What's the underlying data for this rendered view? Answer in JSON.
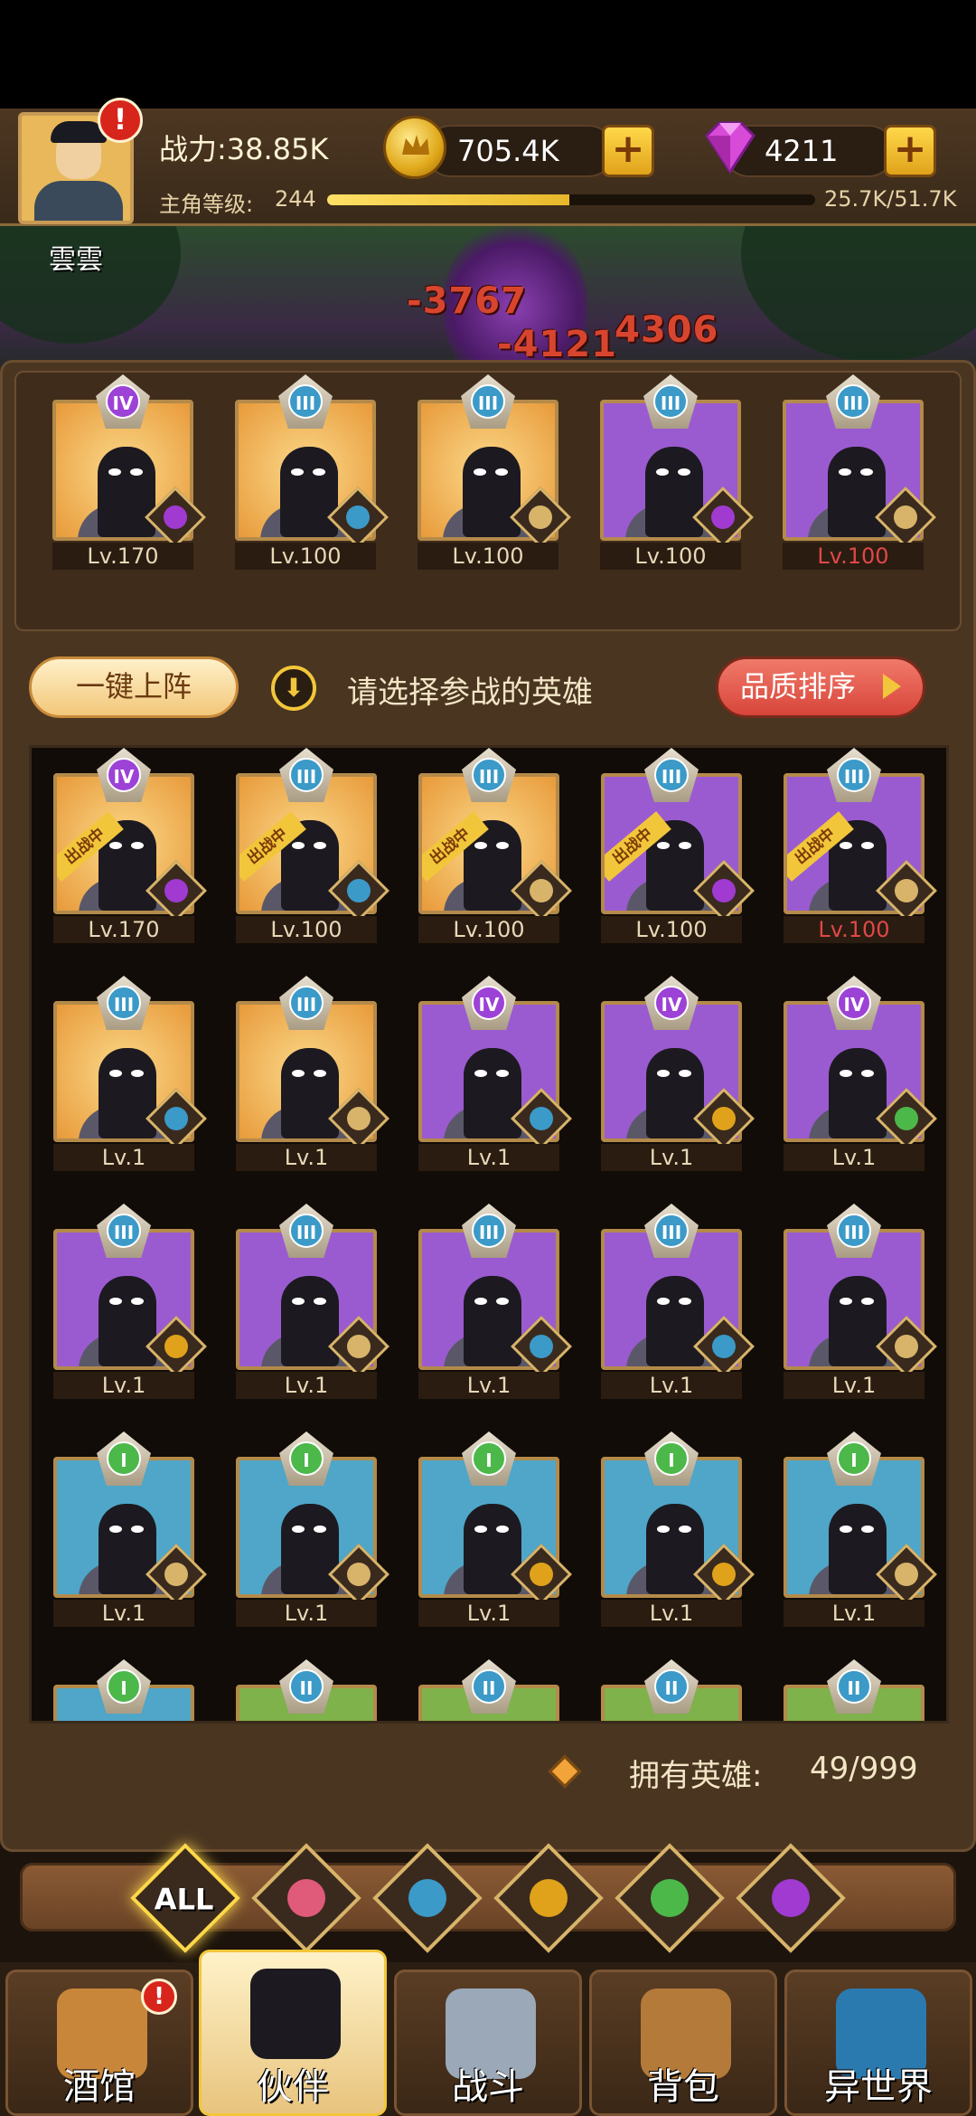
{
  "player": {
    "name": "雲雲",
    "power_text": "战力:38.85K",
    "level_label": "主角等级:",
    "level_value": "244",
    "xp_text": "25.7K/51.7K",
    "xp_progress": 0.497
  },
  "resources": {
    "gold": "705.4K",
    "gems": "4211"
  },
  "battle": {
    "damage_numbers": [
      "-3767",
      "-4121",
      "4306"
    ]
  },
  "team": [
    {
      "rank": "IV",
      "bg": "gold",
      "faction": "demon",
      "level": "Lv.170",
      "level_red": false
    },
    {
      "rank": "III",
      "bg": "gold",
      "faction": "water",
      "level": "Lv.100",
      "level_red": false
    },
    {
      "rank": "III",
      "bg": "gold",
      "faction": "knight",
      "level": "Lv.100",
      "level_red": false
    },
    {
      "rank": "III",
      "bg": "purple",
      "faction": "demon",
      "level": "Lv.100",
      "level_red": false
    },
    {
      "rank": "III",
      "bg": "purple",
      "faction": "knight",
      "level": "Lv.100",
      "level_red": true
    }
  ],
  "actions": {
    "auto_deploy": "一键上阵",
    "hint": "请选择参战的英雄",
    "sort": "品质排序",
    "deployed_tag": "出战中"
  },
  "roster": [
    {
      "rank": "IV",
      "bg": "gold",
      "faction": "demon",
      "level": "Lv.170",
      "deployed": true,
      "level_red": false
    },
    {
      "rank": "III",
      "bg": "gold",
      "faction": "water",
      "level": "Lv.100",
      "deployed": true,
      "level_red": false
    },
    {
      "rank": "III",
      "bg": "gold",
      "faction": "knight",
      "level": "Lv.100",
      "deployed": true,
      "level_red": false
    },
    {
      "rank": "III",
      "bg": "purple",
      "faction": "demon",
      "level": "Lv.100",
      "deployed": true,
      "level_red": false
    },
    {
      "rank": "III",
      "bg": "purple",
      "faction": "knight",
      "level": "Lv.100",
      "deployed": true,
      "level_red": true
    },
    {
      "rank": "III",
      "bg": "gold",
      "faction": "water",
      "level": "Lv.1",
      "deployed": false,
      "level_red": false
    },
    {
      "rank": "III",
      "bg": "gold",
      "faction": "knight",
      "level": "Lv.1",
      "deployed": false,
      "level_red": false
    },
    {
      "rank": "IV",
      "bg": "purple",
      "faction": "water",
      "level": "Lv.1",
      "deployed": false,
      "level_red": false
    },
    {
      "rank": "IV",
      "bg": "purple",
      "faction": "beast",
      "level": "Lv.1",
      "deployed": false,
      "level_red": false
    },
    {
      "rank": "IV",
      "bg": "purple",
      "faction": "elf",
      "level": "Lv.1",
      "deployed": false,
      "level_red": false
    },
    {
      "rank": "III",
      "bg": "purple",
      "faction": "beast",
      "level": "Lv.1",
      "deployed": false,
      "level_red": false
    },
    {
      "rank": "III",
      "bg": "purple",
      "faction": "knight",
      "level": "Lv.1",
      "deployed": false,
      "level_red": false
    },
    {
      "rank": "III",
      "bg": "purple",
      "faction": "water",
      "level": "Lv.1",
      "deployed": false,
      "level_red": false
    },
    {
      "rank": "III",
      "bg": "purple",
      "faction": "water",
      "level": "Lv.1",
      "deployed": false,
      "level_red": false
    },
    {
      "rank": "III",
      "bg": "purple",
      "faction": "knight",
      "level": "Lv.1",
      "deployed": false,
      "level_red": false
    },
    {
      "rank": "I",
      "bg": "blue",
      "faction": "knight",
      "level": "Lv.1",
      "deployed": false,
      "level_red": false
    },
    {
      "rank": "I",
      "bg": "blue",
      "faction": "knight",
      "level": "Lv.1",
      "deployed": false,
      "level_red": false
    },
    {
      "rank": "I",
      "bg": "blue",
      "faction": "beast",
      "level": "Lv.1",
      "deployed": false,
      "level_red": false
    },
    {
      "rank": "I",
      "bg": "blue",
      "faction": "beast",
      "level": "Lv.1",
      "deployed": false,
      "level_red": false
    },
    {
      "rank": "I",
      "bg": "blue",
      "faction": "knight",
      "level": "Lv.1",
      "deployed": false,
      "level_red": false
    },
    {
      "rank": "I",
      "bg": "blue",
      "faction": "",
      "level": "",
      "deployed": false,
      "level_red": false
    },
    {
      "rank": "II",
      "bg": "green",
      "faction": "",
      "level": "",
      "deployed": false,
      "level_red": false
    },
    {
      "rank": "II",
      "bg": "green",
      "faction": "",
      "level": "",
      "deployed": false,
      "level_red": false
    },
    {
      "rank": "II",
      "bg": "green",
      "faction": "",
      "level": "",
      "deployed": false,
      "level_red": false
    },
    {
      "rank": "II",
      "bg": "green",
      "faction": "",
      "level": "",
      "deployed": false,
      "level_red": false
    }
  ],
  "owned": {
    "label": "拥有英雄:",
    "value": "49/999"
  },
  "filters": [
    {
      "id": "all",
      "label": "ALL",
      "icon": "all-icon"
    },
    {
      "id": "knight",
      "label": "",
      "icon": "knight-faction-icon",
      "color": "#e05a7a"
    },
    {
      "id": "water",
      "label": "",
      "icon": "water-faction-icon",
      "color": "#3b9ac8"
    },
    {
      "id": "beast",
      "label": "",
      "icon": "beast-faction-icon",
      "color": "#e0a21a"
    },
    {
      "id": "elf",
      "label": "",
      "icon": "elf-faction-icon",
      "color": "#4cb84a"
    },
    {
      "id": "demon",
      "label": "",
      "icon": "demon-faction-icon",
      "color": "#a03ad0"
    }
  ],
  "nav": [
    {
      "label": "酒馆",
      "icon": "tavern-mug-icon",
      "active": false,
      "alert": true
    },
    {
      "label": "伙伴",
      "icon": "partner-icon",
      "active": true,
      "alert": false
    },
    {
      "label": "战斗",
      "icon": "battle-swords-icon",
      "active": false,
      "alert": false
    },
    {
      "label": "背包",
      "icon": "backpack-icon",
      "active": false,
      "alert": false
    },
    {
      "label": "异世界",
      "icon": "portal-icon",
      "active": false,
      "alert": false
    }
  ],
  "faction_colors": {
    "demon": "#a03ad0",
    "water": "#3b9ac8",
    "knight": "#d8b46a",
    "beast": "#e0a21a",
    "elf": "#4cb84a"
  }
}
